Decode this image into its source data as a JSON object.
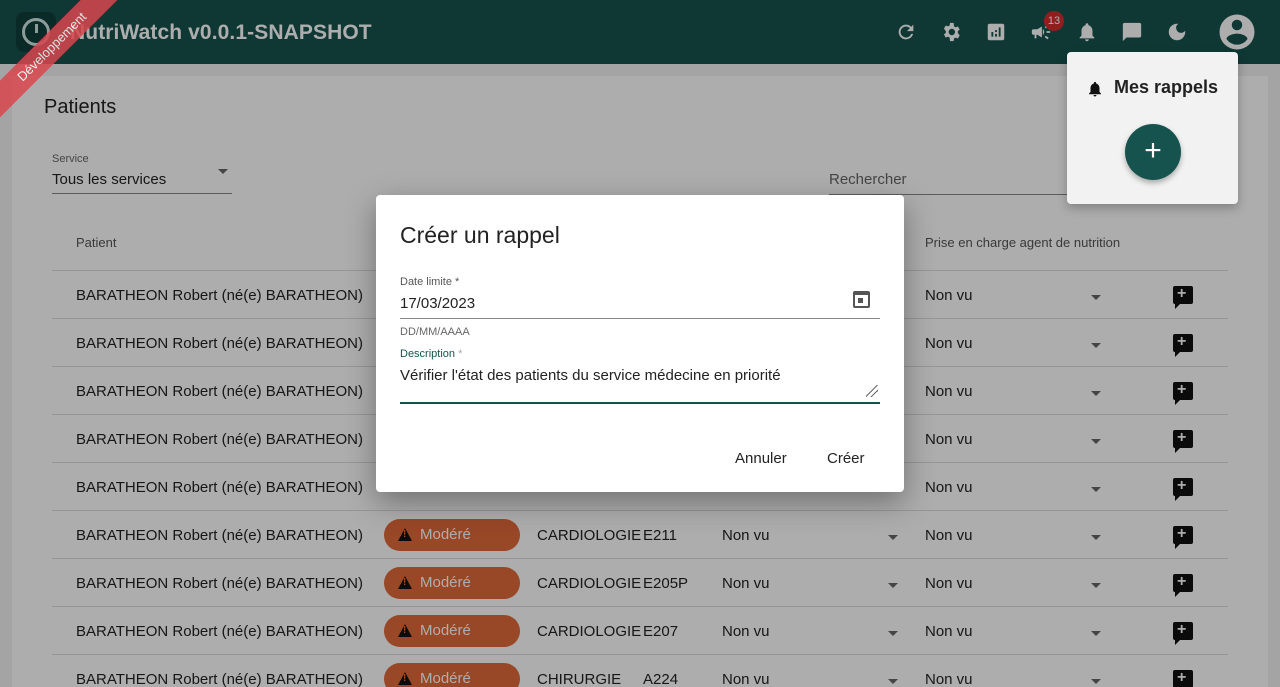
{
  "app": {
    "title": "NutriWatch v0.0.1-SNAPSHOT",
    "env_ribbon": "Développement",
    "notification_count": "13"
  },
  "toolbar": [
    "refresh-icon",
    "settings-icon",
    "analytics-icon",
    "campaign-icon",
    "bell-icon",
    "chat-icon",
    "dark-mode-icon",
    "account-icon"
  ],
  "page": {
    "title": "Patients"
  },
  "filters": {
    "service_label": "Service",
    "service_value": "Tous les services",
    "search_placeholder": "Rechercher"
  },
  "table": {
    "headers": {
      "patient": "Patient",
      "nutrition_agent": "Prise en charge agent de nutrition"
    },
    "rows": [
      {
        "patient": "BARATHEON Robert (né(e) BARATHEON)",
        "severity": "",
        "service": "",
        "room": "",
        "status1": "",
        "status2": "Non vu"
      },
      {
        "patient": "BARATHEON Robert (né(e) BARATHEON)",
        "severity": "",
        "service": "",
        "room": "",
        "status1": "",
        "status2": "Non vu"
      },
      {
        "patient": "BARATHEON Robert (né(e) BARATHEON)",
        "severity": "",
        "service": "",
        "room": "",
        "status1": "",
        "status2": "Non vu"
      },
      {
        "patient": "BARATHEON Robert (né(e) BARATHEON)",
        "severity": "",
        "service": "",
        "room": "",
        "status1": "",
        "status2": "Non vu"
      },
      {
        "patient": "BARATHEON Robert (né(e) BARATHEON)",
        "severity": "",
        "service": "",
        "room": "",
        "status1": "",
        "status2": "Non vu"
      },
      {
        "patient": "BARATHEON Robert (né(e) BARATHEON)",
        "severity": "Modéré",
        "service": "CARDIOLOGIE",
        "room": "E211",
        "status1": "Non vu",
        "status2": "Non vu"
      },
      {
        "patient": "BARATHEON Robert (né(e) BARATHEON)",
        "severity": "Modéré",
        "service": "CARDIOLOGIE",
        "room": "E205P",
        "status1": "Non vu",
        "status2": "Non vu"
      },
      {
        "patient": "BARATHEON Robert (né(e) BARATHEON)",
        "severity": "Modéré",
        "service": "CARDIOLOGIE",
        "room": "E207",
        "status1": "Non vu",
        "status2": "Non vu"
      },
      {
        "patient": "BARATHEON Robert (né(e) BARATHEON)",
        "severity": "Modéré",
        "service": "CHIRURGIE",
        "room": "A224",
        "status1": "Non vu",
        "status2": "Non vu"
      }
    ]
  },
  "reminders": {
    "title": "Mes rappels",
    "add_label": "+"
  },
  "dialog": {
    "title": "Créer un rappel",
    "date_label": "Date limite *",
    "date_value": "17/03/2023",
    "date_helper": "DD/MM/AAAA",
    "description_label": "Description",
    "description_required": "*",
    "description_value": "Vérifier l'état des patients du service médecine en priorité",
    "cancel_label": "Annuler",
    "create_label": "Créer"
  }
}
